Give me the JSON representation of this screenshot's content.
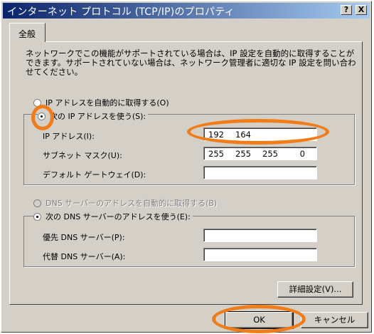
{
  "window": {
    "title": "インターネット プロトコル (TCP/IP)のプロパティ",
    "help_button": "?",
    "close_button": "X"
  },
  "tab": {
    "label": "全般"
  },
  "description": "ネットワークでこの機能がサポートされている場合は、IP 設定を自動的に取得することができます。サポートされていない場合は、ネットワーク管理者に適切な IP 設定を問い合わせてください。",
  "ip": {
    "auto_label": "IP アドレスを自動的に取得する(O)",
    "manual_label": "次の IP アドレスを使う(S):",
    "selected": "manual",
    "address_label": "IP アドレス(I):",
    "address": [
      "192",
      "164",
      "",
      ""
    ],
    "subnet_label": "サブネット マスク(U):",
    "subnet": [
      "255",
      "255",
      "255",
      "0"
    ],
    "gateway_label": "デフォルト ゲートウェイ(D):",
    "gateway": [
      "",
      "",
      "",
      ""
    ]
  },
  "dns": {
    "auto_label": "DNS サーバーのアドレスを自動的に取得する(B)",
    "manual_label": "次の DNS サーバーのアドレスを使う(E):",
    "preferred_label": "優先 DNS サーバー(P):",
    "preferred": [
      "",
      "",
      "",
      ""
    ],
    "alternate_label": "代替 DNS サーバー(A):",
    "alternate": [
      "",
      "",
      "",
      ""
    ]
  },
  "buttons": {
    "advanced": "詳細設定(V)...",
    "ok": "OK",
    "cancel": "キャンセル"
  },
  "highlight_color": "#f07d1a"
}
